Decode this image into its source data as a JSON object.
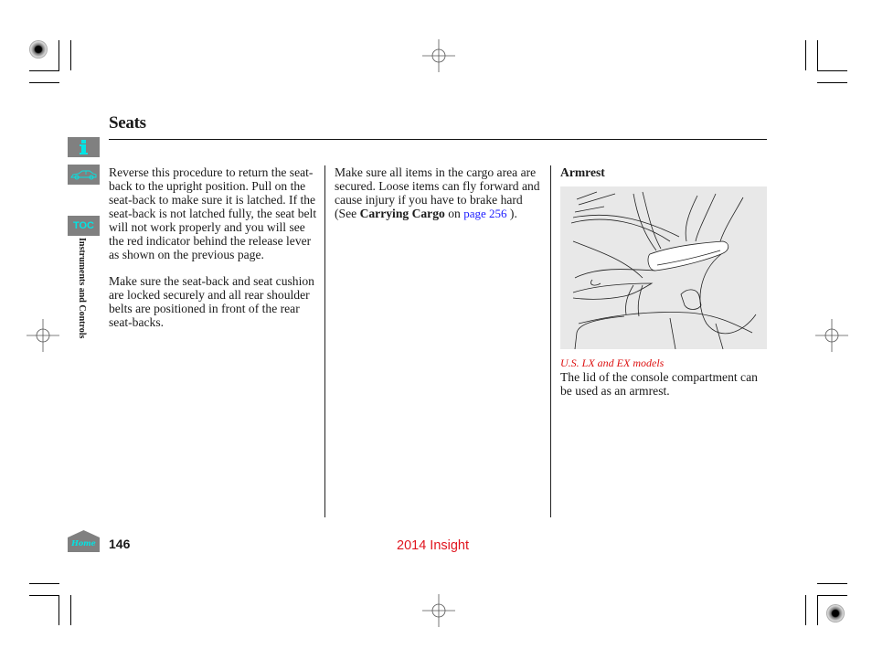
{
  "page": {
    "title": "Seats",
    "section_tab": "Instruments and Controls",
    "page_number": "146",
    "footer": "2014 Insight"
  },
  "nav": {
    "info_icon": "info-icon",
    "car_icon": "car-icon",
    "toc_label": "TOC",
    "home_label": "Home"
  },
  "column1": {
    "paragraphs": [
      "Reverse this procedure to return the seat-back to the upright position. Pull on the seat-back to make sure it is latched. If the seat-back is not latched fully, the seat belt will not work properly and you will see the red indicator behind the release lever as shown on the previous page.",
      "Make sure the seat-back and seat cushion are locked securely and all rear shoulder belts are positioned in front of the rear seat-backs."
    ]
  },
  "column2": {
    "text_before": "Make sure all items in the cargo area are secured. Loose items can fly forward and cause injury if you have to brake hard (See ",
    "bold_ref": "Carrying Cargo",
    "text_on": " on ",
    "link": "page 256",
    "text_after": " )."
  },
  "column3": {
    "heading": "Armrest",
    "figure_alt": "Console armrest illustration",
    "caption": "U.S. LX and EX models",
    "body": "The lid of the console compartment can be used as an armrest."
  },
  "colors": {
    "accent_cyan": "#00e5e5",
    "nav_gray": "#808080",
    "link_blue": "#1a1aff",
    "footer_red": "#e0141e",
    "caption_red": "#dd1111"
  }
}
